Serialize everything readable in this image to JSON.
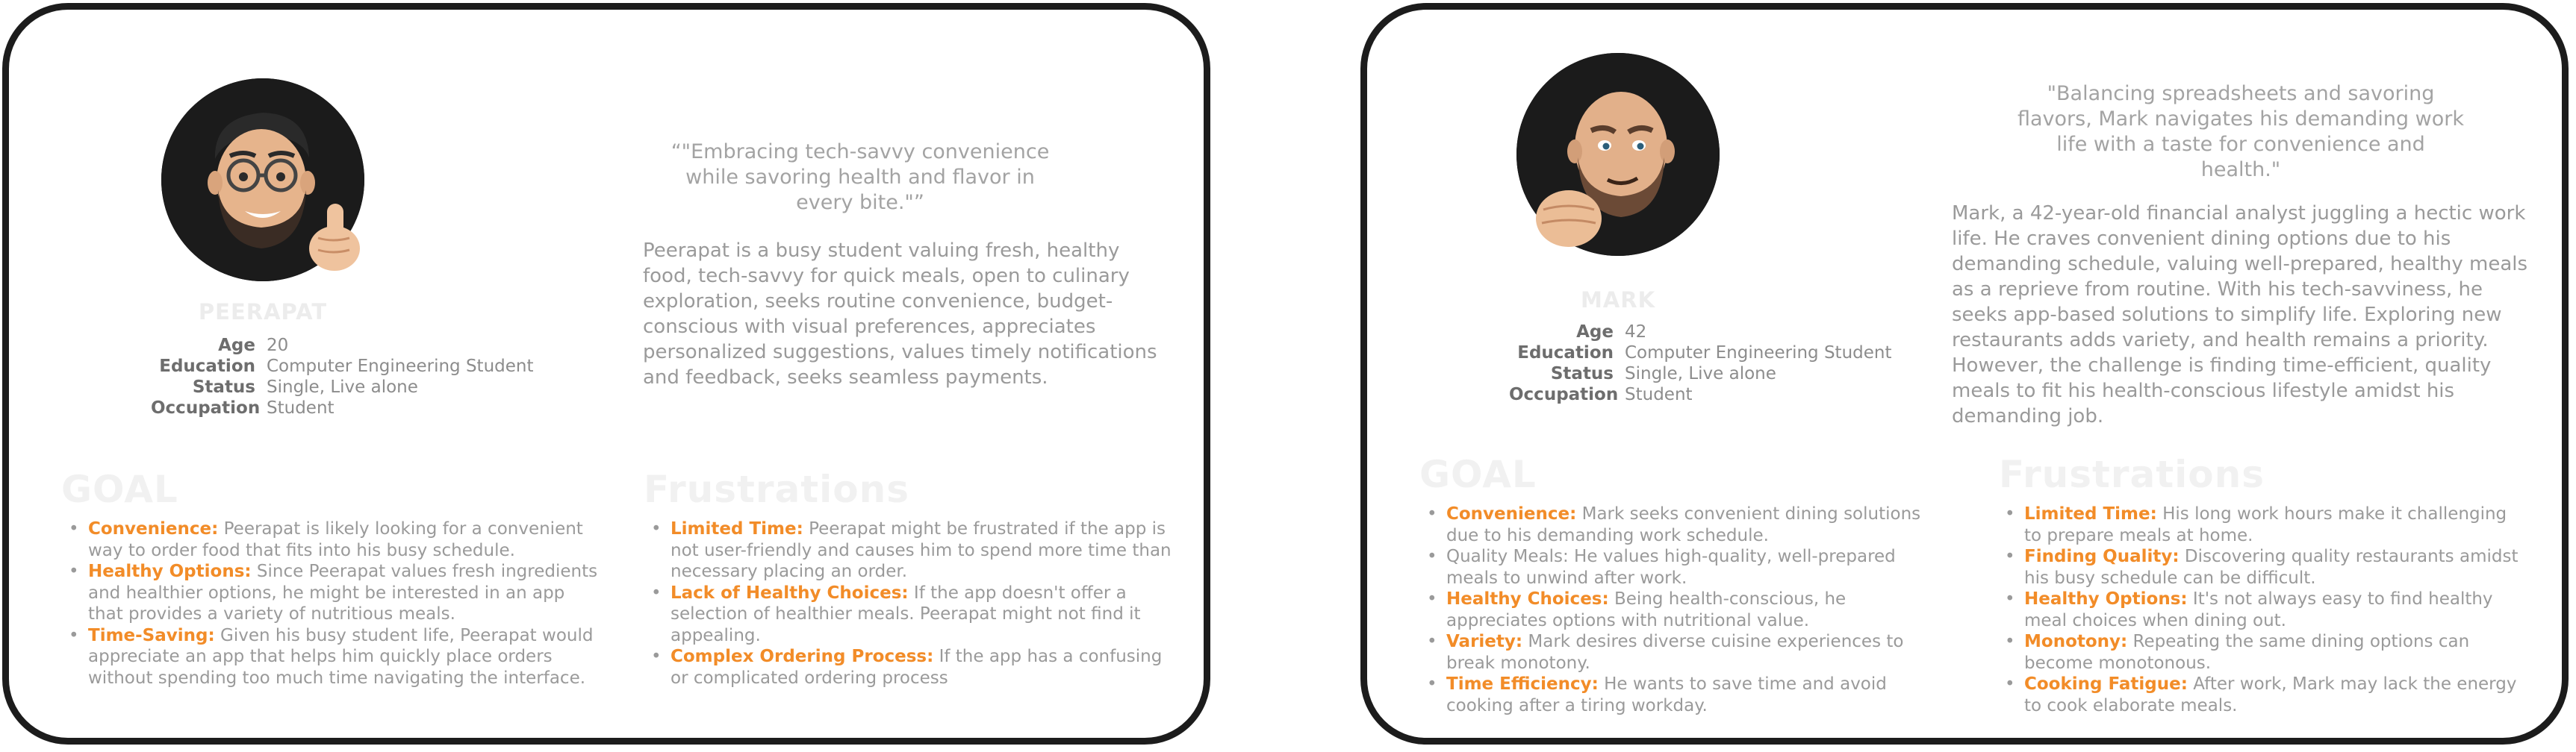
{
  "colors": {
    "accent": "#f28c28",
    "card_border": "#1c1c1c"
  },
  "personas": [
    {
      "name": "PEERAPAT",
      "info": [
        {
          "label": "Age",
          "value": "20"
        },
        {
          "label": "Education",
          "value": "Computer Engineering Student"
        },
        {
          "label": "Status",
          "value": "Single, Live alone"
        },
        {
          "label": "Occupation",
          "value": "Student"
        }
      ],
      "quote": "“\"Embracing tech-savvy convenience while savoring health and flavor in every bite.\"”",
      "bio": "Peerapat is a busy student valuing fresh, healthy food, tech-savvy for quick meals, open to culinary exploration, seeks routine convenience, budget-conscious with visual preferences, appreciates personalized suggestions, values timely notifications and feedback, seeks seamless payments.",
      "goal_title": "GOAL",
      "goals": [
        {
          "key": "Convenience:",
          "text": " Peerapat is likely looking for a convenient way to order food that fits into his busy schedule."
        },
        {
          "key": "Healthy Options:",
          "text": " Since Peerapat values fresh ingredients and healthier options, he might be interested in an app that provides a variety of nutritious meals."
        },
        {
          "key": "Time-Saving:",
          "text": " Given his busy student life, Peerapat would appreciate an app that helps him quickly place orders without spending too much time navigating the interface."
        }
      ],
      "frustrations_title": "Frustrations",
      "frustrations": [
        {
          "key": "Limited Time:",
          "text": "  Peerapat might be frustrated if the app is not user-friendly and causes him to spend more time than necessary placing an order."
        },
        {
          "key": "Lack of Healthy Choices:",
          "text": " If the app doesn't offer a selection of healthier meals. Peerapat might not find it appealing."
        },
        {
          "key": "Complex Ordering Process:",
          "text": " If the app has a confusing or complicated ordering process"
        }
      ]
    },
    {
      "name": "MARK",
      "info": [
        {
          "label": "Age",
          "value": "42"
        },
        {
          "label": "Education",
          "value": "Computer Engineering Student"
        },
        {
          "label": "Status",
          "value": "Single, Live alone"
        },
        {
          "label": "Occupation",
          "value": "Student"
        }
      ],
      "quote": "\"Balancing spreadsheets and savoring flavors, Mark navigates his demanding work life with a taste for convenience and health.\"",
      "bio": "Mark, a 42-year-old financial analyst juggling a hectic work life. He craves convenient dining options due to his demanding schedule, valuing well-prepared, healthy meals as a reprieve from routine. With his tech-savviness, he seeks app-based solutions to simplify life. Exploring new restaurants adds variety, and health remains a priority. However, the challenge is finding time-efficient, quality meals to fit his health-conscious lifestyle amidst his demanding job.",
      "goal_title": "GOAL",
      "goals": [
        {
          "key": "Convenience:",
          "text": " Mark seeks convenient dining solutions due to his demanding work schedule."
        },
        {
          "key": "",
          "text": "Quality Meals: He values high-quality, well-prepared meals to unwind after work."
        },
        {
          "key": "Healthy Choices:",
          "text": " Being health-conscious, he appreciates options with nutritional value."
        },
        {
          "key": "Variety:",
          "text": " Mark desires diverse cuisine experiences to break monotony."
        },
        {
          "key": "Time Efficiency:",
          "text": " He wants to save time and avoid cooking after a tiring workday."
        }
      ],
      "frustrations_title": "Frustrations",
      "frustrations": [
        {
          "key": "Limited Time:",
          "text": " His long work hours make it challenging to prepare meals at home."
        },
        {
          "key": "Finding Quality:",
          "text": " Discovering quality restaurants amidst his busy schedule can be difficult."
        },
        {
          "key": "Healthy Options:",
          "text": " It's not always easy to find healthy meal choices when dining out."
        },
        {
          "key": "Monotony:",
          "text": " Repeating the same dining options can become monotonous."
        },
        {
          "key": "Cooking Fatigue:",
          "text": " After work, Mark may lack the energy to cook elaborate meals."
        }
      ]
    }
  ]
}
